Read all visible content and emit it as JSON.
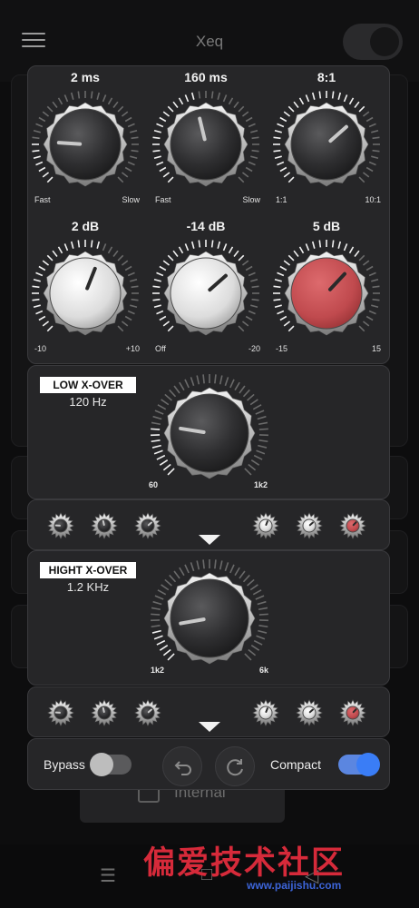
{
  "app": {
    "title": "Xeq"
  },
  "background": {
    "internal_label": "Internal"
  },
  "knobs_top": [
    {
      "value": "2 ms",
      "min_label": "Fast",
      "max_label": "Slow",
      "style": "dark",
      "level": 0.18
    },
    {
      "value": "160 ms",
      "min_label": "Fast",
      "max_label": "Slow",
      "style": "dark",
      "level": 0.45
    },
    {
      "value": "8:1",
      "min_label": "1:1",
      "max_label": "10:1",
      "style": "dark",
      "level": 0.68
    },
    {
      "value": "2 dB",
      "min_label": "-10",
      "max_label": "+10",
      "style": "light",
      "level": 0.58
    },
    {
      "value": "-14 dB",
      "min_label": "Off",
      "max_label": "-20",
      "style": "light",
      "level": 0.68
    },
    {
      "value": "5 dB",
      "min_label": "-15",
      "max_label": "15",
      "style": "red",
      "level": 0.66
    }
  ],
  "low_crossover": {
    "title": "LOW X-OVER",
    "frequency": "120 Hz",
    "min_label": "60",
    "max_label": "1k2",
    "level": 0.2
  },
  "high_crossover": {
    "title": "HIGHT X-OVER",
    "frequency": "1.2 KHz",
    "min_label": "1k2",
    "max_label": "6k",
    "level": 0.13
  },
  "bottom": {
    "bypass_label": "Bypass",
    "bypass_on": false,
    "compact_label": "Compact",
    "compact_on": true
  },
  "colors": {
    "panel": "#262628",
    "accent_red": "#c64a4e",
    "toggle_blue": "#3a7df6"
  },
  "icons": [
    "menu-icon",
    "undo-icon",
    "reset-icon",
    "expand-arrow-icon"
  ],
  "watermark": {
    "text": "偏爱技术社区",
    "url": "www.paijishu.com"
  }
}
